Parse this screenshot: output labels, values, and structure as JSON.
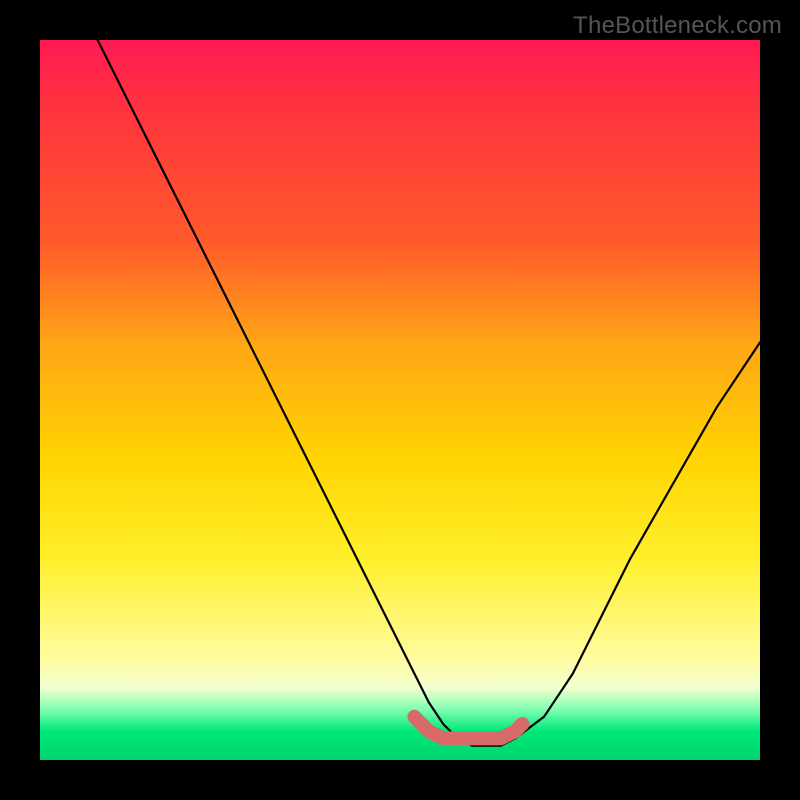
{
  "watermark": "TheBottleneck.com",
  "chart_data": {
    "type": "line",
    "title": "",
    "xlabel": "",
    "ylabel": "",
    "xlim": [
      0,
      100
    ],
    "ylim": [
      0,
      100
    ],
    "series": [
      {
        "name": "bottleneck-curve",
        "x": [
          8,
          12,
          16,
          20,
          24,
          28,
          32,
          36,
          40,
          44,
          48,
          52,
          54,
          56,
          58,
          60,
          62,
          64,
          66,
          70,
          74,
          78,
          82,
          86,
          90,
          94,
          98,
          100
        ],
        "values": [
          100,
          92,
          84,
          76,
          68,
          60,
          52,
          44,
          36,
          28,
          20,
          12,
          8,
          5,
          3,
          2,
          2,
          2,
          3,
          6,
          12,
          20,
          28,
          35,
          42,
          49,
          55,
          58
        ]
      }
    ],
    "trough_marker": {
      "name": "optimal-range",
      "color": "#d96a6a",
      "x": [
        52,
        54,
        56,
        58,
        60,
        62,
        64,
        66,
        67
      ],
      "values": [
        6,
        4,
        3,
        3,
        3,
        3,
        3,
        4,
        5
      ]
    }
  },
  "colors": {
    "curve": "#000000",
    "marker": "#d96a6a",
    "background_top": "#ff1a55",
    "background_bottom": "#00d46d"
  }
}
